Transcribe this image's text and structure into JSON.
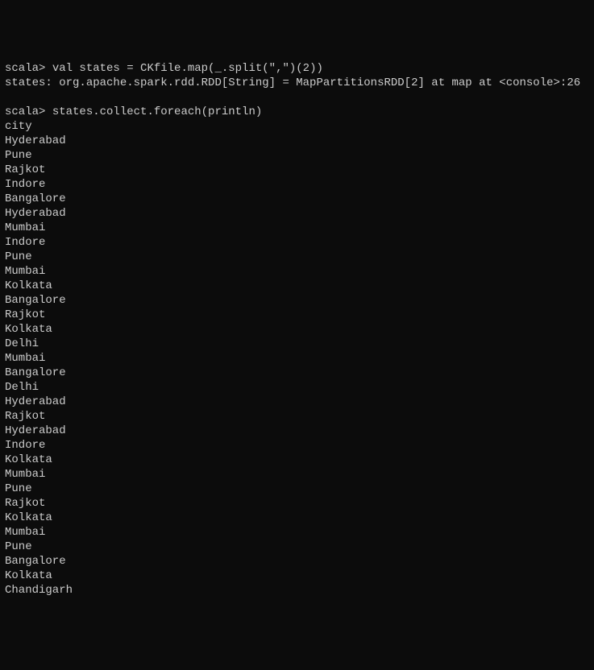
{
  "lines": [
    {
      "type": "command",
      "prompt": "scala>",
      "text": " val states = CKfile.map(_.split(\",\")(2))"
    },
    {
      "type": "result",
      "text": "states: org.apache.spark.rdd.RDD[String] = MapPartitionsRDD[2] at map at <console>:26"
    },
    {
      "type": "blank",
      "text": ""
    },
    {
      "type": "command",
      "prompt": "scala>",
      "text": " states.collect.foreach(println)"
    },
    {
      "type": "output",
      "text": "city"
    },
    {
      "type": "output",
      "text": "Hyderabad"
    },
    {
      "type": "output",
      "text": "Pune"
    },
    {
      "type": "output",
      "text": "Rajkot"
    },
    {
      "type": "output",
      "text": "Indore"
    },
    {
      "type": "output",
      "text": "Bangalore"
    },
    {
      "type": "output",
      "text": "Hyderabad"
    },
    {
      "type": "output",
      "text": "Mumbai"
    },
    {
      "type": "output",
      "text": "Indore"
    },
    {
      "type": "output",
      "text": "Pune"
    },
    {
      "type": "output",
      "text": "Mumbai"
    },
    {
      "type": "output",
      "text": "Kolkata"
    },
    {
      "type": "output",
      "text": "Bangalore"
    },
    {
      "type": "output",
      "text": "Rajkot"
    },
    {
      "type": "output",
      "text": "Kolkata"
    },
    {
      "type": "output",
      "text": "Delhi"
    },
    {
      "type": "output",
      "text": "Mumbai"
    },
    {
      "type": "output",
      "text": "Bangalore"
    },
    {
      "type": "output",
      "text": "Delhi"
    },
    {
      "type": "output",
      "text": "Hyderabad"
    },
    {
      "type": "output",
      "text": "Rajkot"
    },
    {
      "type": "output",
      "text": "Hyderabad"
    },
    {
      "type": "output",
      "text": "Indore"
    },
    {
      "type": "output",
      "text": "Kolkata"
    },
    {
      "type": "output",
      "text": "Mumbai"
    },
    {
      "type": "output",
      "text": "Pune"
    },
    {
      "type": "output",
      "text": "Rajkot"
    },
    {
      "type": "output",
      "text": "Kolkata"
    },
    {
      "type": "output",
      "text": "Mumbai"
    },
    {
      "type": "output",
      "text": "Pune"
    },
    {
      "type": "output",
      "text": "Bangalore"
    },
    {
      "type": "output",
      "text": "Kolkata"
    },
    {
      "type": "output",
      "text": "Chandigarh"
    }
  ]
}
